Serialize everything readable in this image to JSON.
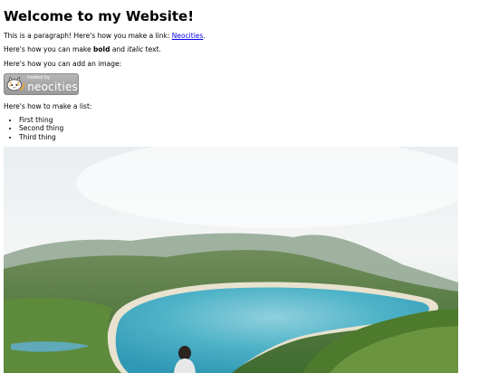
{
  "page": {
    "title": "Welcome to my Website!",
    "intro_prefix": "This is a paragraph! Here's how you make a link: ",
    "link_label": "Neocities",
    "intro_suffix": ".",
    "format_prefix": "Here's how you can make ",
    "bold_word": "bold",
    "format_middle": " and ",
    "italic_word": "italic",
    "format_suffix": " text.",
    "image_intro": "Here's how you can add an image:",
    "list_intro": "Here's how to make a list:",
    "list_items": [
      "First thing",
      "Second thing",
      "Third thing"
    ]
  },
  "badge": {
    "small_text": "hosted by",
    "big_text": "neocities"
  },
  "colors": {
    "link": "#0000ee",
    "lake": "#4fb3c8",
    "sky": "#f2f4f5"
  }
}
